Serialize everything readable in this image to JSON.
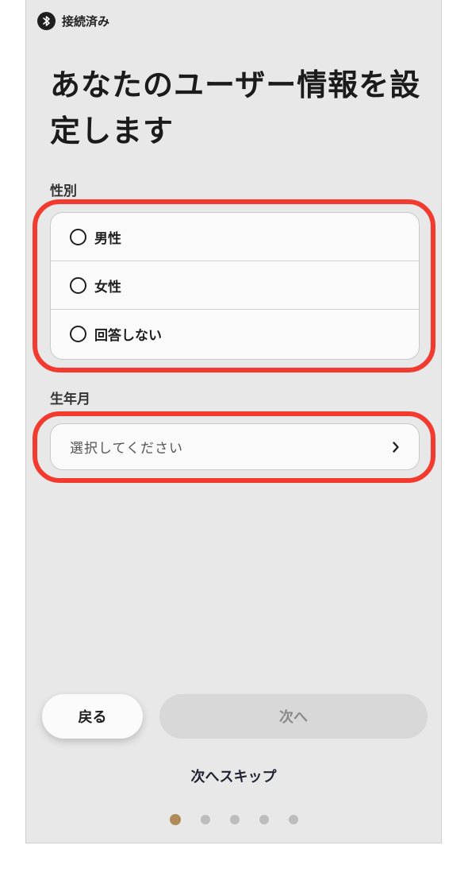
{
  "status": {
    "icon": "bluetooth-icon",
    "text": "接続済み"
  },
  "title": "あなたのユーザー情報を設定します",
  "gender": {
    "label": "性別",
    "options": [
      {
        "label": "男性",
        "selected": false
      },
      {
        "label": "女性",
        "selected": false
      },
      {
        "label": "回答しない",
        "selected": false
      }
    ]
  },
  "birth": {
    "label": "生年月",
    "placeholder": "選択してください",
    "icon": "chevron-right-icon"
  },
  "buttons": {
    "back": "戻る",
    "next": "次へ",
    "skip": "次へスキップ"
  },
  "pagination": {
    "current": 1,
    "total": 5
  },
  "colors": {
    "highlight": "#f23a2f",
    "active_dot": "#b08a59",
    "background": "#e8e8e8"
  }
}
